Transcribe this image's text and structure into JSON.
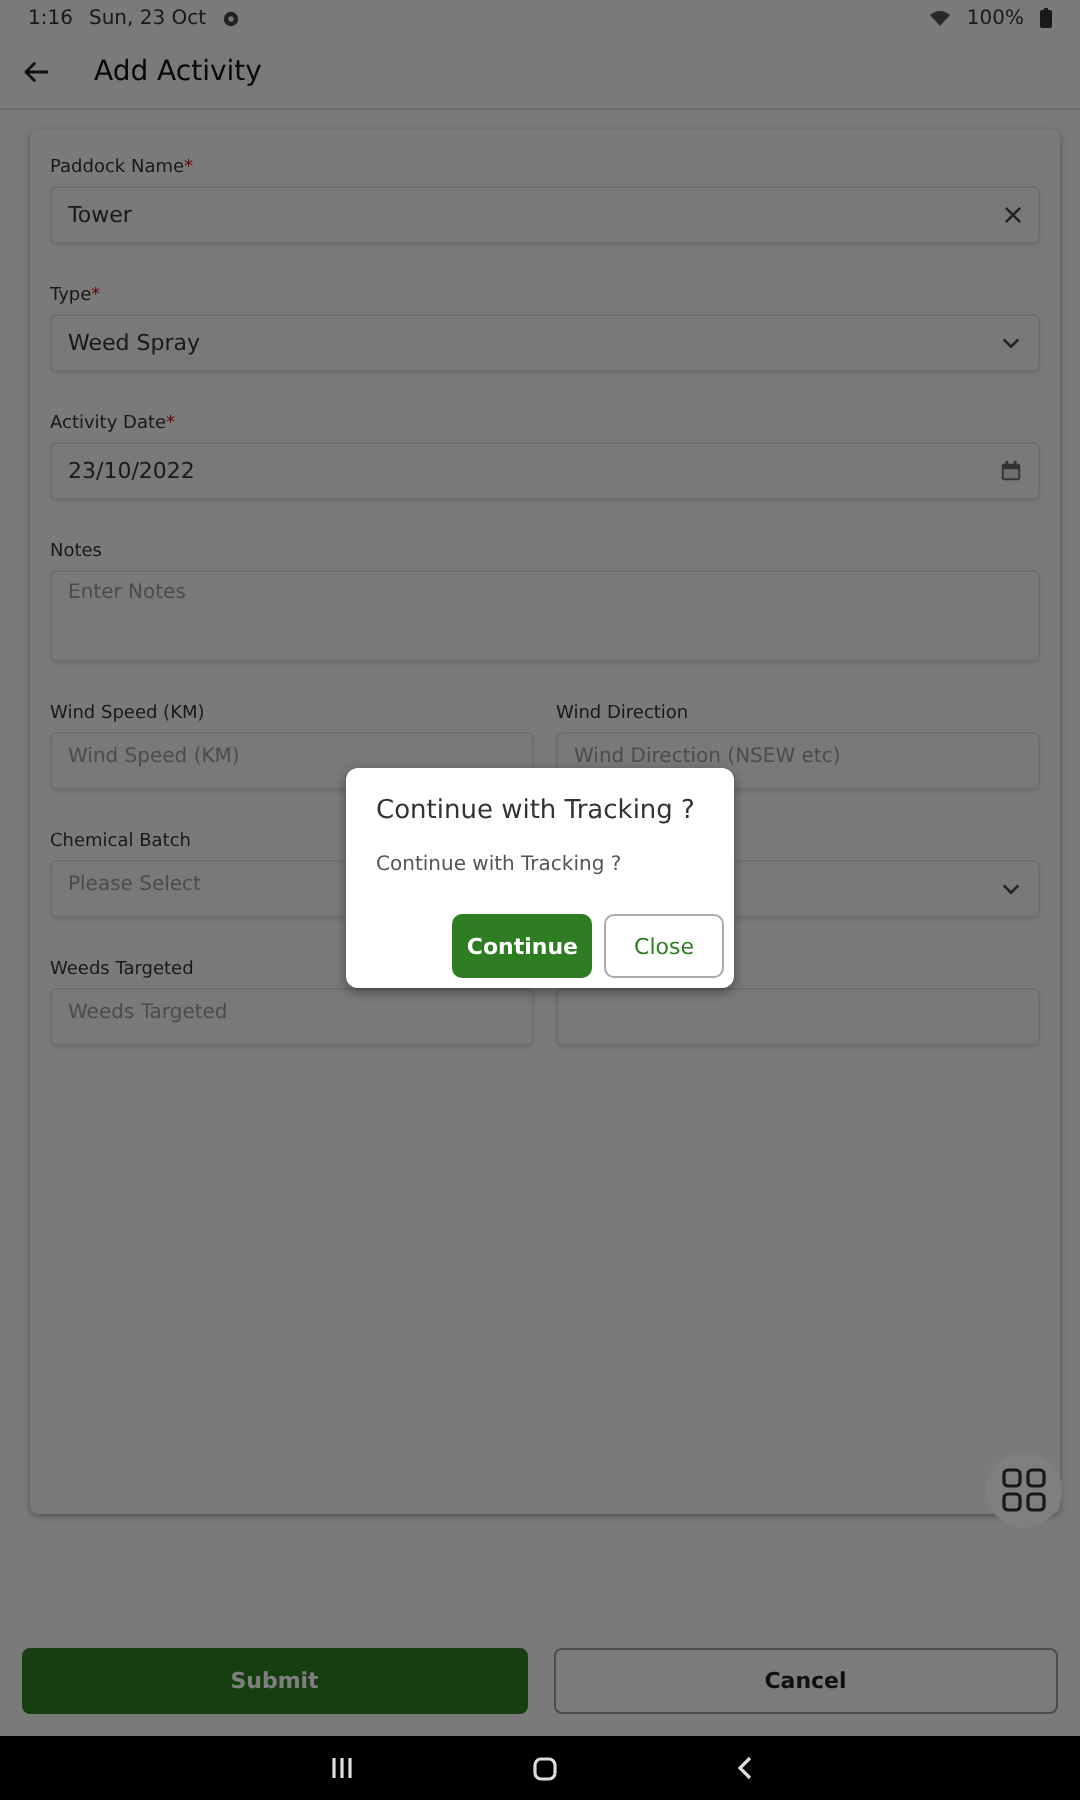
{
  "status_bar": {
    "time": "1:16",
    "date": "Sun, 23 Oct",
    "battery": "100%"
  },
  "app_bar": {
    "title": "Add Activity"
  },
  "form": {
    "rows": [
      [
        {
          "kind": "text",
          "label": "Paddock Name",
          "required_mark": "*",
          "value": "Tower",
          "clearable": true
        }
      ],
      [
        {
          "kind": "select",
          "label": "Type",
          "required_mark": "*",
          "value": "Weed Spray",
          "chevron": true
        }
      ],
      [
        {
          "kind": "date",
          "label": "Activity Date",
          "required_mark": "*",
          "value": "23/10/2022"
        }
      ],
      [
        {
          "kind": "textarea",
          "label": "Notes",
          "placeholder": "Enter Notes"
        }
      ],
      [
        {
          "kind": "text",
          "label": "Wind Speed (KM)",
          "placeholder": "Wind Speed (KM)"
        },
        {
          "kind": "text",
          "label": "Wind Direction",
          "placeholder": "Wind Direction (NSEW etc)"
        }
      ],
      [
        {
          "kind": "select",
          "label": "Chemical Batch",
          "placeholder": "Please Select"
        },
        {
          "kind": "select",
          "chevron": true
        }
      ],
      [
        {
          "kind": "text",
          "label": "Weeds Targeted",
          "placeholder": "Weeds Targeted"
        },
        {
          "kind": "text"
        }
      ]
    ]
  },
  "actions": [
    {
      "label": "Submit",
      "kind": "primary"
    },
    {
      "label": "Cancel",
      "kind": "outline"
    }
  ],
  "dialog": {
    "title": "Continue with Tracking ?",
    "message": "Continue with Tracking ?",
    "buttons": [
      {
        "label": "Continue",
        "kind": "primary"
      },
      {
        "label": "Close",
        "kind": "outline"
      }
    ]
  }
}
